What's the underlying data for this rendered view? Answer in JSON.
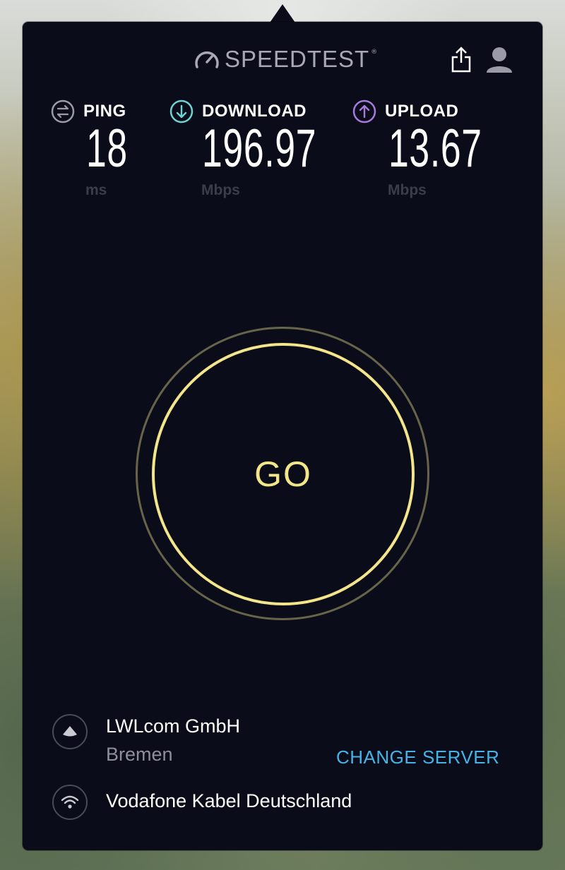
{
  "app": {
    "logo_text": "SPEEDTEST",
    "logo_tm": "®"
  },
  "header": {
    "share_icon": "share-icon",
    "profile_icon": "user-icon"
  },
  "metrics": [
    {
      "label": "PING",
      "value": "18",
      "unit": "ms",
      "icon": "ping-icon",
      "color": "#9a9ba6"
    },
    {
      "label": "DOWNLOAD",
      "value": "196.97",
      "unit": "Mbps",
      "icon": "download-icon",
      "color": "#6fd3d4"
    },
    {
      "label": "UPLOAD",
      "value": "13.67",
      "unit": "Mbps",
      "icon": "upload-icon",
      "color": "#a77bdc"
    }
  ],
  "go_button": {
    "label": "GO",
    "color": "#f2e58a"
  },
  "server": {
    "name": "LWLcom GmbH",
    "city": "Bremen",
    "change_label": "CHANGE SERVER",
    "link_color": "#45b3e6"
  },
  "isp": {
    "name": "Vodafone Kabel Deutschland"
  }
}
